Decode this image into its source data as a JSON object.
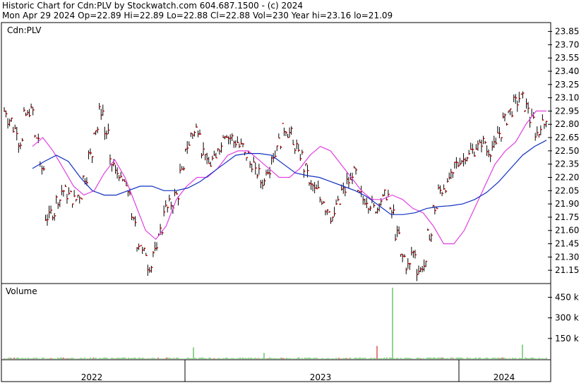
{
  "header": {
    "line1": "Historic Chart for Cdn:PLV  by Stockwatch.com 604.687.1500 - (c) 2024",
    "line2": "Mon Apr 29 2024   Op=22.89   Hi=22.89   Lo=22.88   Cl=22.88   Vol=230   Year hi=23.16   lo=21.09"
  },
  "colors": {
    "ma_short": "#e040e0",
    "ma_long": "#1030c0",
    "price_bar": "#000000",
    "close_tick": "#cc0000",
    "volume_bar": "#22aa22",
    "volume_spike_red": "#cc0000",
    "frame": "#000000"
  },
  "chart_data": [
    {
      "type": "ohlc",
      "title": "Cdn:PLV",
      "ylim": [
        21.0,
        23.95
      ],
      "ytick_labels": [
        "23.85",
        "23.70",
        "23.55",
        "23.40",
        "23.25",
        "23.10",
        "22.95",
        "22.80",
        "22.65",
        "22.50",
        "22.35",
        "22.20",
        "22.05",
        "21.90",
        "21.75",
        "21.60",
        "21.45",
        "21.30",
        "21.15"
      ],
      "ytick_values": [
        23.85,
        23.7,
        23.55,
        23.4,
        23.25,
        23.1,
        22.95,
        22.8,
        22.65,
        22.5,
        22.35,
        22.2,
        22.05,
        21.9,
        21.75,
        21.6,
        21.45,
        21.3,
        21.15
      ],
      "x_period_labels": [
        "2022",
        "2023",
        "2024"
      ],
      "close_approx": [
        22.95,
        22.85,
        22.75,
        22.6,
        22.9,
        22.95,
        22.65,
        22.3,
        21.75,
        21.8,
        21.95,
        22.05,
        22.0,
        21.95,
        22.0,
        22.2,
        22.45,
        22.75,
        22.95,
        22.7,
        22.35,
        22.25,
        22.15,
        22.05,
        21.7,
        21.45,
        21.35,
        21.2,
        21.35,
        21.6,
        21.85,
        21.9,
        22.0,
        22.25,
        22.55,
        22.7,
        22.75,
        22.5,
        22.35,
        22.4,
        22.55,
        22.7,
        22.65,
        22.6,
        22.55,
        22.45,
        22.35,
        22.25,
        22.15,
        22.3,
        22.45,
        22.6,
        22.75,
        22.7,
        22.55,
        22.45,
        22.3,
        22.1,
        22.05,
        21.95,
        21.85,
        21.75,
        21.9,
        22.05,
        22.15,
        22.25,
        22.0,
        21.95,
        21.9,
        21.85,
        21.95,
        22.0,
        21.8,
        21.55,
        21.3,
        21.2,
        21.35,
        21.15,
        21.2,
        21.55,
        21.85,
        22.05,
        22.1,
        22.2,
        22.35,
        22.4,
        22.45,
        22.5,
        22.55,
        22.6,
        22.5,
        22.55,
        22.7,
        22.85,
        22.95,
        23.05,
        23.1,
        23.0,
        22.85,
        22.7,
        22.8,
        22.88
      ],
      "series": [
        {
          "name": "",
          "kind": "short-moving-average",
          "values": [
            22.55,
            22.65,
            22.5,
            22.3,
            22.1,
            22.0,
            22.05,
            22.25,
            22.4,
            22.2,
            21.9,
            21.6,
            21.5,
            21.65,
            21.95,
            22.1,
            22.2,
            22.2,
            22.3,
            22.45,
            22.5,
            22.5,
            22.4,
            22.3,
            22.2,
            22.2,
            22.3,
            22.45,
            22.55,
            22.5,
            22.35,
            22.2,
            22.05,
            21.95,
            21.95,
            22.0,
            21.95,
            21.85,
            21.8,
            21.65,
            21.45,
            21.45,
            21.6,
            21.85,
            22.1,
            22.35,
            22.5,
            22.6,
            22.8,
            22.95,
            22.95
          ]
        },
        {
          "name": "",
          "kind": "long-moving-average",
          "values": [
            22.3,
            22.38,
            22.45,
            22.38,
            22.2,
            22.05,
            22.0,
            22.0,
            22.05,
            22.1,
            22.1,
            22.05,
            22.05,
            22.08,
            22.15,
            22.25,
            22.35,
            22.45,
            22.47,
            22.47,
            22.45,
            22.35,
            22.25,
            22.22,
            22.2,
            22.15,
            22.1,
            22.05,
            21.98,
            21.88,
            21.78,
            21.78,
            21.8,
            21.85,
            21.87,
            21.88,
            21.9,
            21.95,
            22.03,
            22.15,
            22.3,
            22.45,
            22.55,
            22.62
          ]
        }
      ]
    },
    {
      "type": "bar",
      "title": "Volume",
      "ytick_labels": [
        "450 k",
        "300 k",
        "150 k"
      ],
      "ytick_values": [
        450,
        300,
        150
      ],
      "ylim": [
        0,
        550
      ],
      "unit": "k",
      "notable_spikes_k": [
        {
          "period": "2023",
          "value": 520,
          "color": "#22aa22"
        },
        {
          "period": "2023",
          "value": 95,
          "color": "#cc0000"
        },
        {
          "period": "2024",
          "value": 105,
          "color": "#22aa22"
        },
        {
          "period": "2022",
          "value": 85,
          "color": "#22aa22"
        },
        {
          "period": "2023",
          "value": 45,
          "color": "#22aa22"
        }
      ]
    }
  ]
}
